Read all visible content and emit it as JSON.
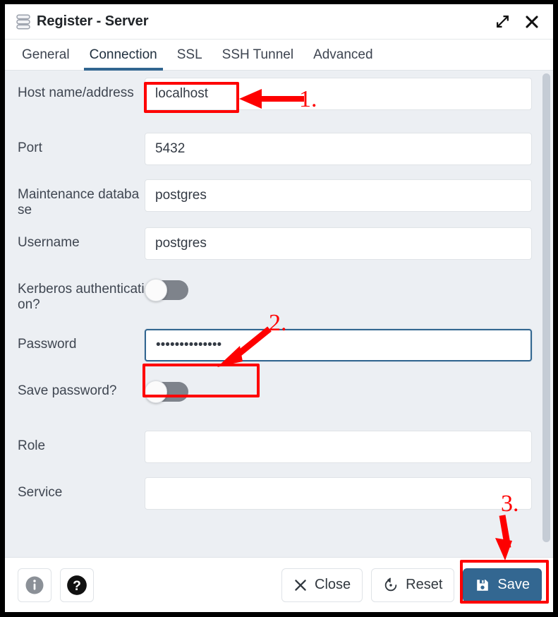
{
  "window": {
    "title": "Register - Server",
    "icon": "server-stack-icon",
    "controls": {
      "maximize": "expand-diagonal-icon",
      "close": "close-x-icon"
    }
  },
  "tabs": [
    {
      "label": "General",
      "active": false
    },
    {
      "label": "Connection",
      "active": true
    },
    {
      "label": "SSL",
      "active": false
    },
    {
      "label": "SSH Tunnel",
      "active": false
    },
    {
      "label": "Advanced",
      "active": false
    }
  ],
  "form": {
    "fields": [
      {
        "label": "Host name/address",
        "value": "localhost",
        "type": "text",
        "placeholder": ""
      },
      {
        "label": "Port",
        "value": "5432",
        "type": "text",
        "placeholder": ""
      },
      {
        "label": "Maintenance database",
        "value": "postgres",
        "type": "text",
        "placeholder": ""
      },
      {
        "label": "Username",
        "value": "postgres",
        "type": "text",
        "placeholder": ""
      },
      {
        "label": "Kerberos authentication?",
        "value": "off",
        "type": "toggle",
        "placeholder": ""
      },
      {
        "label": "Password",
        "value": "••••••••••••••",
        "type": "password",
        "placeholder": ""
      },
      {
        "label": "Save password?",
        "value": "off",
        "type": "toggle",
        "placeholder": ""
      },
      {
        "label": "Role",
        "value": "",
        "type": "text",
        "placeholder": ""
      },
      {
        "label": "Service",
        "value": "",
        "type": "text",
        "placeholder": ""
      }
    ]
  },
  "footer": {
    "info_icon": "info-circle-icon",
    "help_icon": "question-circle-icon",
    "close_label": "Close",
    "reset_label": "Reset",
    "save_label": "Save"
  },
  "annotations": [
    {
      "number": "1.",
      "target": "host-name-input"
    },
    {
      "number": "2.",
      "target": "password-input"
    },
    {
      "number": "3.",
      "target": "save-button"
    }
  ],
  "colors": {
    "accent": "#326690",
    "primary_button": "#336791",
    "annotation": "#fe0000",
    "body_bg": "#eceff3",
    "frame": "#000000"
  }
}
